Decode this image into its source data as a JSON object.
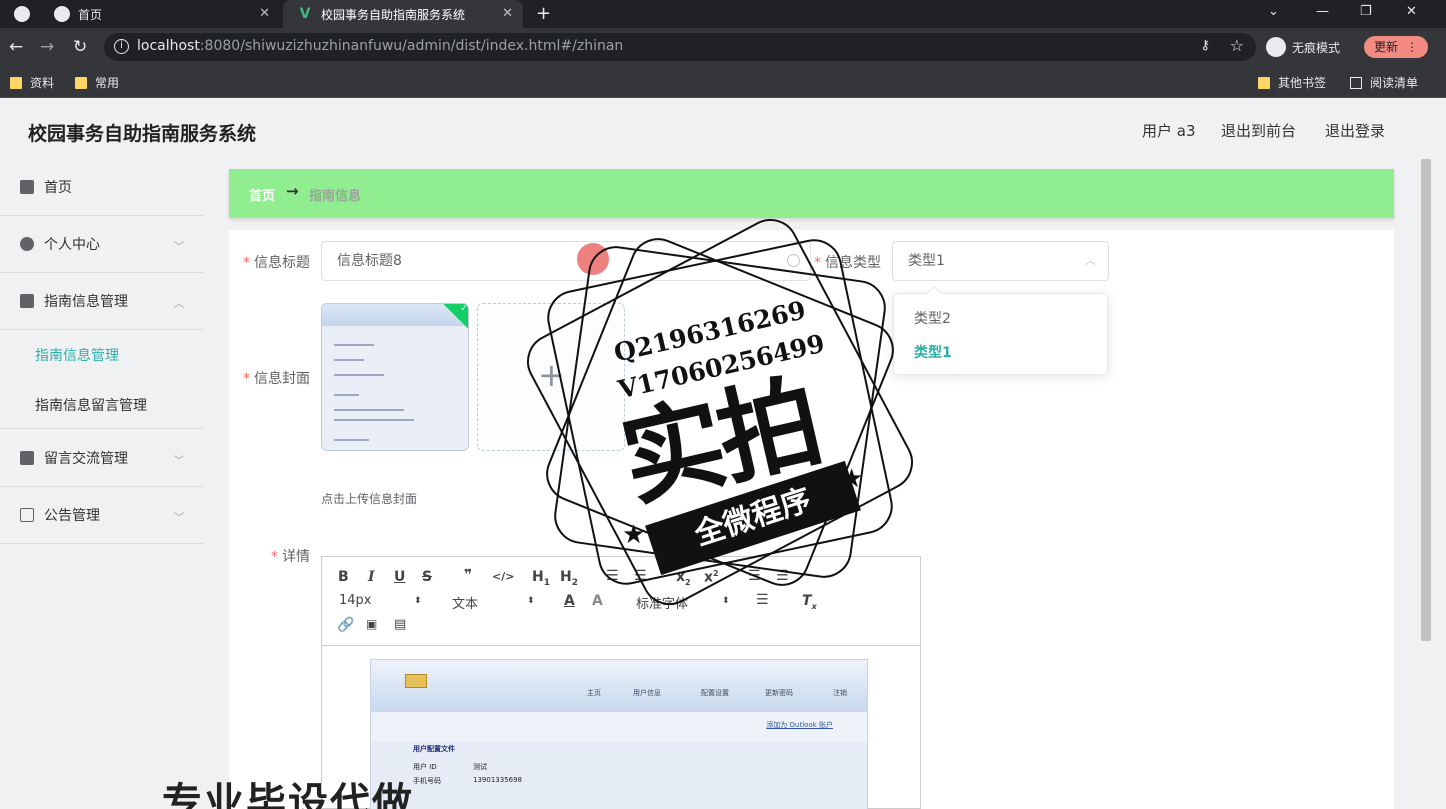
{
  "browser": {
    "tabs": [
      {
        "label": "首页"
      },
      {
        "label": "校园事务自助指南服务系统"
      }
    ],
    "url_host": "localhost",
    "url_rest": ":8080/shiwuzizhuzhinanfuwu/admin/dist/index.html#/zhinan",
    "incognito_label": "无痕模式",
    "update_label": "更新",
    "bookmarks": [
      "资料",
      "常用"
    ],
    "bookmarks_right": [
      "其他书签",
      "阅读清单"
    ]
  },
  "app": {
    "title": "校园事务自助指南服务系统",
    "user_label": "用户 a3",
    "to_front_label": "退出到前台",
    "logout_label": "退出登录"
  },
  "sidebar": {
    "items": [
      {
        "label": "首页"
      },
      {
        "label": "个人中心"
      },
      {
        "label": "指南信息管理"
      },
      {
        "label": "留言交流管理"
      },
      {
        "label": "公告管理"
      }
    ],
    "sub_items": [
      {
        "label": "指南信息管理"
      },
      {
        "label": "指南信息留言管理"
      }
    ]
  },
  "breadcrumb": {
    "home": "首页",
    "arrow": "→",
    "current": "指南信息"
  },
  "form": {
    "title_label": "信息标题",
    "title_value": "信息标题8",
    "type_label": "信息类型",
    "type_value": "类型1",
    "type_options": [
      "类型2",
      "类型1"
    ],
    "cover_label": "信息封面",
    "upload_tip": "点击上传信息封面",
    "detail_label": "详情",
    "required_mark": "*"
  },
  "editor": {
    "font_size": "14px",
    "text_style": "文本",
    "font_family": "标准字体",
    "toolbar_icons": [
      "bold-icon",
      "italic-icon",
      "underline-icon",
      "strike-icon",
      "quote-icon",
      "code-icon",
      "h1-icon",
      "h2-icon",
      "ordered-list-icon",
      "bullet-list-icon",
      "subscript-icon",
      "superscript-icon",
      "outdent-icon",
      "indent-icon",
      "font-color-icon",
      "background-color-icon",
      "align-icon",
      "clear-format-icon",
      "link-icon",
      "image-icon",
      "video-icon"
    ],
    "image": {
      "nav": [
        "主页",
        "用户信息",
        "配置设置",
        "更新密码",
        "注销"
      ],
      "outlook_link": "添加为 Outlook 账户",
      "section_title": "用户配置文件",
      "rows": [
        {
          "key": "用户 ID",
          "value": "测试"
        },
        {
          "key": "手机号码",
          "value": "13901335698"
        }
      ]
    }
  },
  "watermark": {
    "contact_q": "Q2196316269",
    "contact_v": "V17060256499",
    "big": "实拍",
    "ribbon": "全微程序",
    "bottom": "专业毕设代做"
  },
  "colors": {
    "breadcrumb_bg": "#90ee90",
    "accent": "#2bb0a8",
    "required": "#f56c6c"
  }
}
